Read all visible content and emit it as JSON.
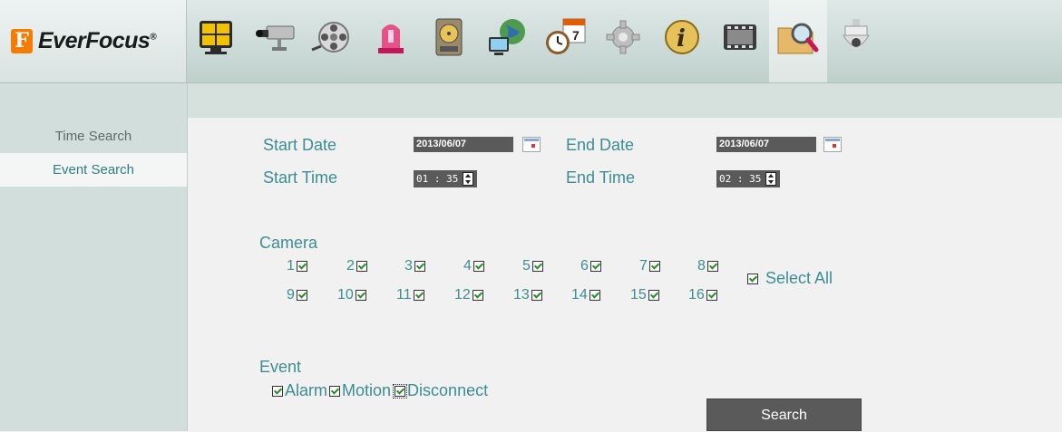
{
  "brand": {
    "mark": "F",
    "name": "EverFocus",
    "reg": "®"
  },
  "toolbar": [
    {
      "icon": "live-view-grid-icon"
    },
    {
      "icon": "camera-icon"
    },
    {
      "icon": "playback-reel-icon"
    },
    {
      "icon": "alarm-light-icon"
    },
    {
      "icon": "hard-disk-icon"
    },
    {
      "icon": "network-icon"
    },
    {
      "icon": "schedule-icon"
    },
    {
      "icon": "settings-gear-icon"
    },
    {
      "icon": "information-icon"
    },
    {
      "icon": "film-backup-icon"
    },
    {
      "icon": "search-folder-icon"
    },
    {
      "icon": "ptz-dome-icon"
    }
  ],
  "sidebar": {
    "items": [
      {
        "label": "Time Search"
      },
      {
        "label": "Event Search"
      }
    ]
  },
  "form": {
    "start_date_label": "Start Date",
    "start_date": "2013/06/07",
    "end_date_label": "End Date",
    "end_date": "2013/06/07",
    "start_time_label": "Start Time",
    "start_time": "01 : 35",
    "end_time_label": "End Time",
    "end_time": "02 : 35"
  },
  "camera": {
    "label": "Camera",
    "channels": [
      "1",
      "2",
      "3",
      "4",
      "5",
      "6",
      "7",
      "8",
      "9",
      "10",
      "11",
      "12",
      "13",
      "14",
      "15",
      "16"
    ],
    "select_all": "Select All"
  },
  "event": {
    "label": "Event",
    "options": [
      "Alarm",
      "Motion",
      "Disconnect"
    ]
  },
  "search_button": "Search"
}
